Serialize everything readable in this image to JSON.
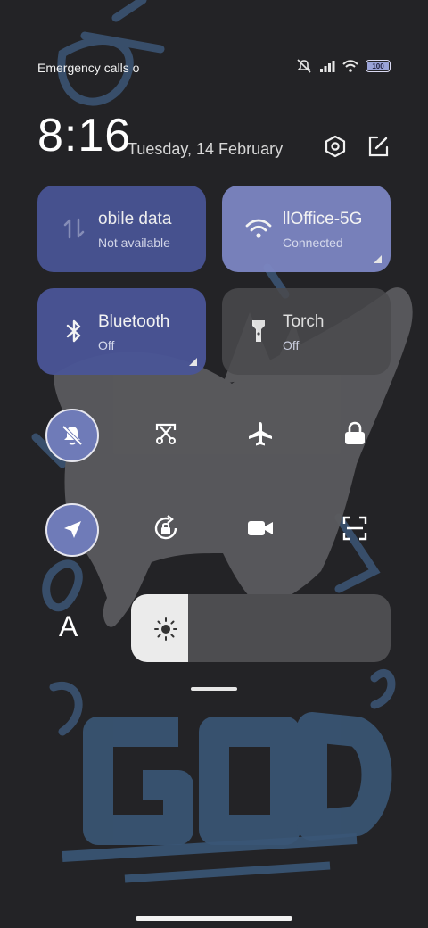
{
  "status_bar": {
    "carrier_text": "Emergency calls o",
    "battery_level": "100",
    "icons": [
      "mute-icon",
      "signal-icon",
      "wifi-icon",
      "battery-icon"
    ]
  },
  "header": {
    "time": "8:16",
    "date": "Tuesday, 14 February",
    "icons": [
      "settings-hex-icon",
      "edit-icon"
    ]
  },
  "tiles": [
    {
      "label": "obile data",
      "sub": "Not available",
      "icon": "mobile-data-icon",
      "color": "#4a5597"
    },
    {
      "label": "llOffice-5G",
      "sub": "Connected",
      "icon": "wifi-icon",
      "color": "#7c86c2"
    },
    {
      "label": "Bluetooth",
      "sub": "Off",
      "icon": "bluetooth-icon",
      "color": "#4a5597"
    },
    {
      "label": "Torch",
      "sub": "Off",
      "icon": "torch-icon",
      "color": "#4a4a4d"
    }
  ],
  "toggles": [
    {
      "icon": "bell-off-icon",
      "active": true
    },
    {
      "icon": "screenshot-cut-icon",
      "active": false
    },
    {
      "icon": "airplane-icon",
      "active": false
    },
    {
      "icon": "lock-icon",
      "active": false
    },
    {
      "icon": "location-icon",
      "active": true
    },
    {
      "icon": "rotation-lock-icon",
      "active": false
    },
    {
      "icon": "video-camera-icon",
      "active": false
    },
    {
      "icon": "scan-icon",
      "active": false
    }
  ],
  "auto_brightness_label": "A",
  "brightness_level": 0.22,
  "colors": {
    "accent": "#6f7bb8",
    "tile_blue": "#4a5597",
    "tile_light": "#7c86c2",
    "background": "#232326"
  }
}
